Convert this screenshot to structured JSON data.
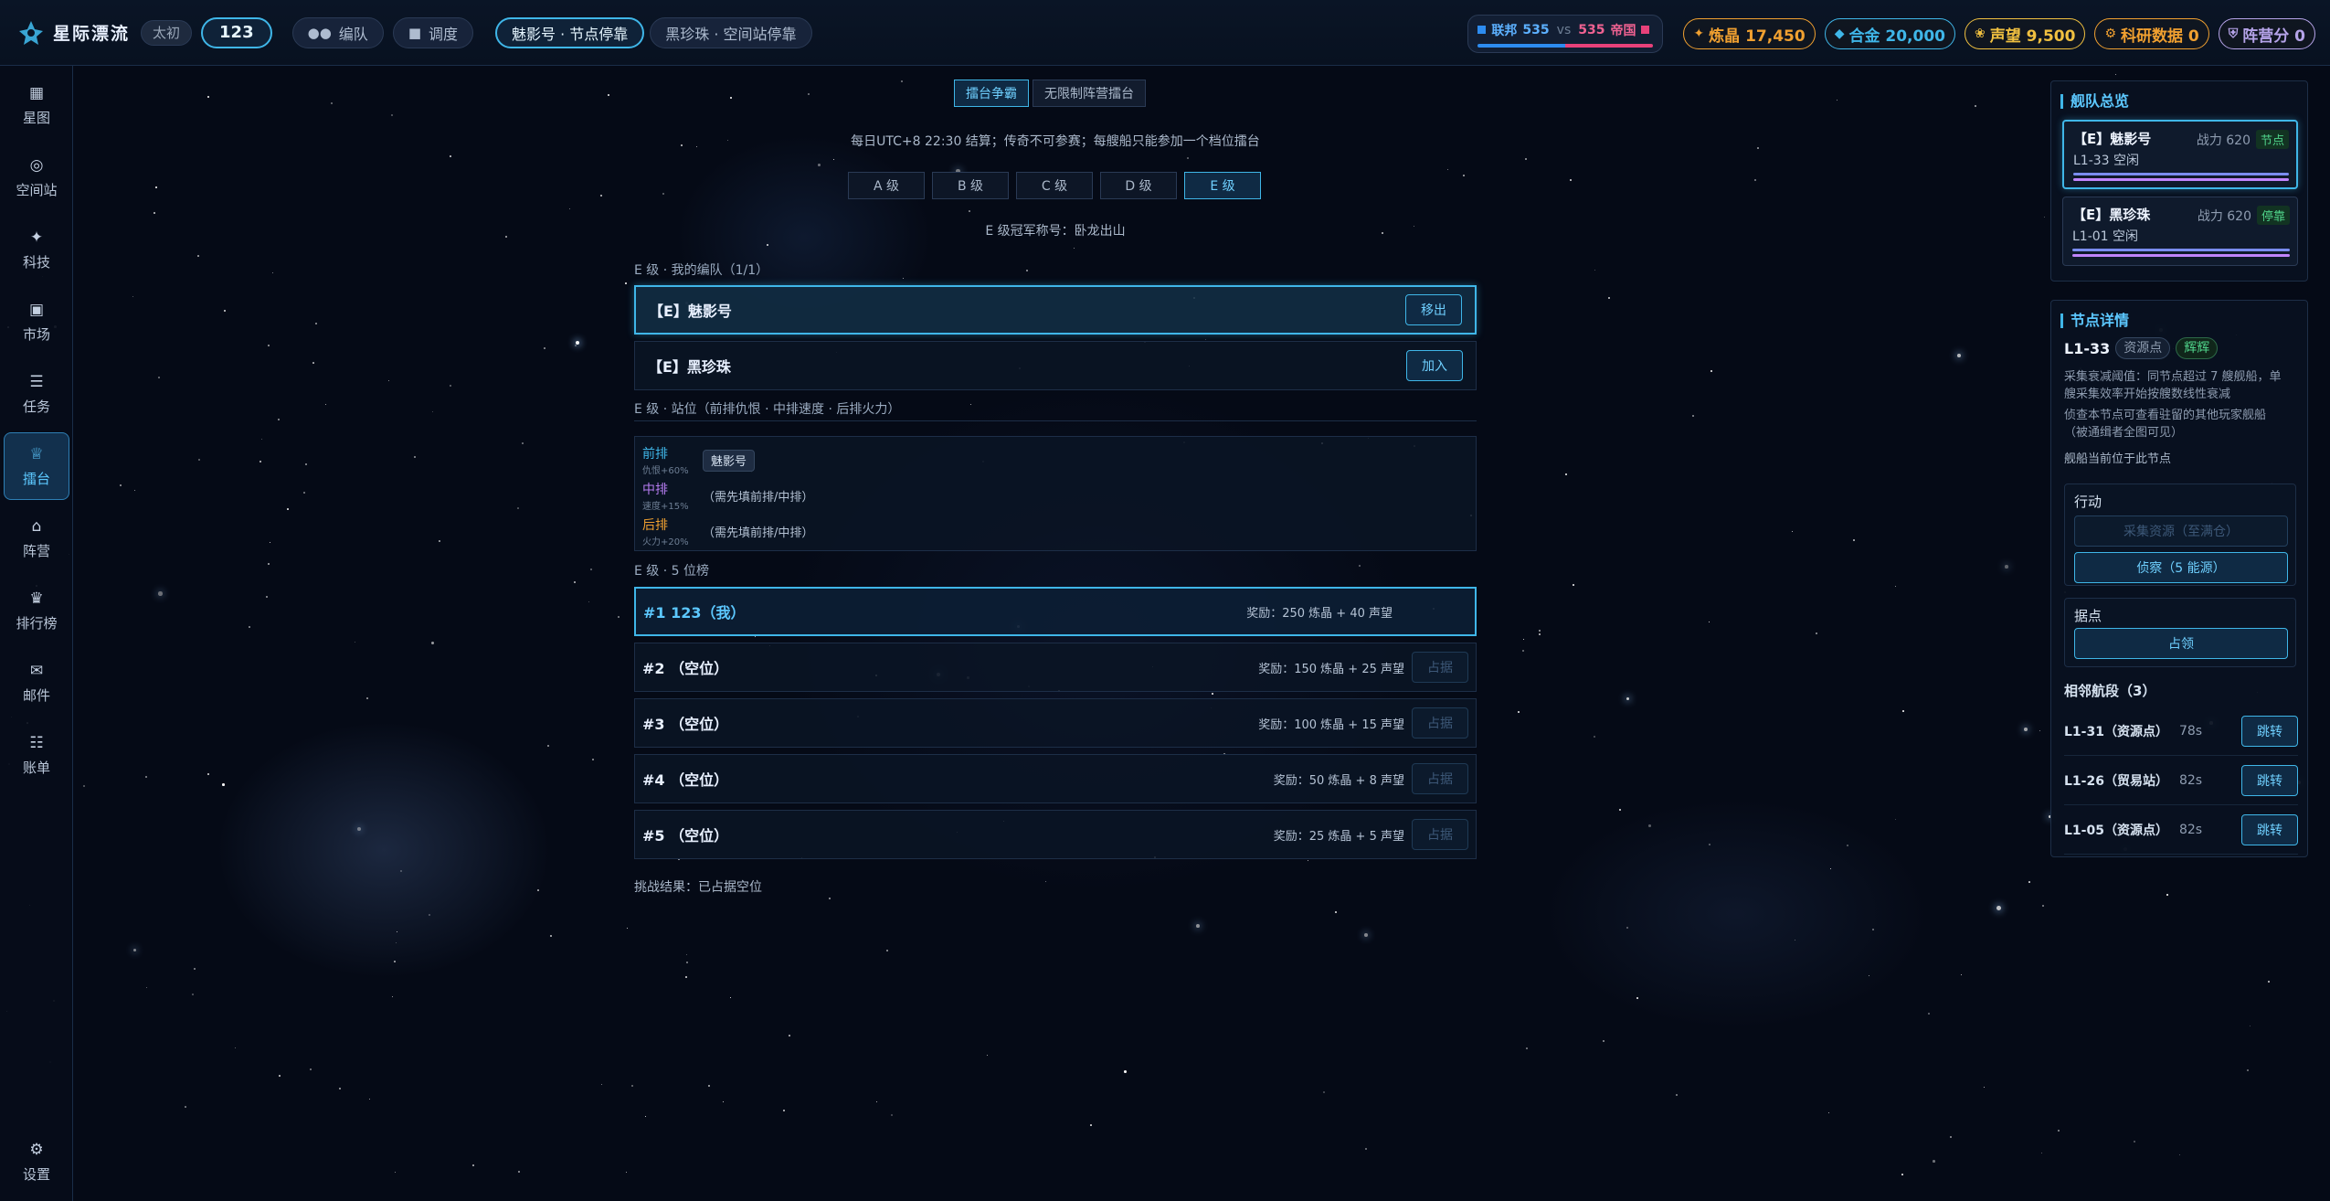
{
  "app": {
    "title": "星际漂流",
    "era_tag": "太初",
    "player_number": "123"
  },
  "topnav": [
    {
      "label": "编队",
      "icon": "users-icon"
    },
    {
      "label": "调度",
      "icon": "layers-icon"
    }
  ],
  "fleet_tabs": [
    {
      "label": "魅影号 · 节点停靠",
      "active": true
    },
    {
      "label": "黑珍珠 · 空间站停靠",
      "active": false
    }
  ],
  "faction": {
    "left_name": "联邦",
    "left_count": "535",
    "vs": "vs",
    "right_count": "535",
    "right_name": "帝国",
    "left_color": "#2d8cf0",
    "right_color": "#e8417a",
    "left_share": 0.5
  },
  "resources": [
    {
      "icon": "crystal-icon",
      "label": "炼晶 17,450",
      "color": "#f0a030"
    },
    {
      "icon": "alloy-icon",
      "label": "合金 20,000",
      "color": "#3fb6e8"
    },
    {
      "icon": "fame-icon",
      "label": "声望 9,500",
      "color": "#f0c040"
    },
    {
      "icon": "research-icon",
      "label": "科研数据 0",
      "color": "#f0a030"
    },
    {
      "icon": "shield-icon",
      "label": "阵营分 0",
      "color": "#b5a3e8"
    }
  ],
  "sidebar": [
    {
      "label": "星图",
      "icon": "map-icon",
      "active": false
    },
    {
      "label": "空间站",
      "icon": "station-icon",
      "active": false
    },
    {
      "label": "科技",
      "icon": "tech-icon",
      "active": false
    },
    {
      "label": "市场",
      "icon": "market-icon",
      "active": false
    },
    {
      "label": "任务",
      "icon": "task-icon",
      "active": false
    },
    {
      "label": "擂台",
      "icon": "trophy-icon",
      "active": true
    },
    {
      "label": "阵营",
      "icon": "camp-icon",
      "active": false
    },
    {
      "label": "排行榜",
      "icon": "crown-icon",
      "active": false
    },
    {
      "label": "邮件",
      "icon": "mail-icon",
      "active": false
    },
    {
      "label": "账单",
      "icon": "bill-icon",
      "active": false
    }
  ],
  "settings_label": "设置",
  "arena": {
    "mode_tabs": [
      {
        "label": "擂台争霸",
        "active": true
      },
      {
        "label": "无限制阵营擂台",
        "active": false
      }
    ],
    "notice": "每日UTC+8 22:30 结算；传奇不可参赛；每艘船只能参加一个档位擂台",
    "grades": [
      {
        "label": "A 级",
        "active": false
      },
      {
        "label": "B 级",
        "active": false
      },
      {
        "label": "C 级",
        "active": false
      },
      {
        "label": "D 级",
        "active": false
      },
      {
        "label": "E 级",
        "active": true
      }
    ],
    "champion": "E 级冠军称号：卧龙出山",
    "my_fleet_title": "E 级 · 我的编队（1/1）",
    "my_fleets": [
      {
        "name": "【E】魅影号",
        "action": "移出",
        "selected": true
      },
      {
        "name": "【E】黑珍珠",
        "action": "加入",
        "selected": false
      }
    ],
    "positions_title": "E 级 · 站位（前排仇恨 · 中排速度 · 后排火力）",
    "positions": [
      {
        "label": "前排",
        "bonus": "仇恨+60%",
        "color": "#3fb6e8",
        "chip": "魅影号",
        "text": ""
      },
      {
        "label": "中排",
        "bonus": "速度+15%",
        "color": "#b57cf0",
        "chip": "",
        "text": "（需先填前排/中排）"
      },
      {
        "label": "后排",
        "bonus": "火力+20%",
        "color": "#f0a030",
        "chip": "",
        "text": "（需先填前排/中排）"
      }
    ],
    "ranking_title": "E 级 · 5 位榜",
    "ranking": [
      {
        "title": "#1 123（我）",
        "reward": "奖励：250 炼晶 + 40 声望",
        "action": "",
        "mine": true
      },
      {
        "title": "#2 （空位）",
        "reward": "奖励：150 炼晶 + 25 声望",
        "action": "占据",
        "mine": false
      },
      {
        "title": "#3 （空位）",
        "reward": "奖励：100 炼晶 + 15 声望",
        "action": "占据",
        "mine": false
      },
      {
        "title": "#4 （空位）",
        "reward": "奖励：50 炼晶 + 8 声望",
        "action": "占据",
        "mine": false
      },
      {
        "title": "#5 （空位）",
        "reward": "奖励：25 炼晶 + 5 声望",
        "action": "占据",
        "mine": false
      }
    ],
    "result": "挑战结果：已占据空位"
  },
  "right_panel": {
    "overview_title": "舰队总览",
    "fleets": [
      {
        "name": "【E】魅影号",
        "power": "战力 620",
        "state": "节点",
        "location": "L1-33 空闲",
        "bar1": "#7a8cf0",
        "bar2": "#c084fc",
        "selected": true
      },
      {
        "name": "【E】黑珍珠",
        "power": "战力 620",
        "state": "停靠",
        "location": "L1-01 空闲",
        "bar1": "#7a8cf0",
        "bar2": "#c084fc",
        "selected": false
      }
    ],
    "node_title": "节点详情",
    "node_id": "L1-33",
    "node_chips": [
      {
        "label": "资源点",
        "color": "#8e9cb0"
      },
      {
        "label": "辉辉",
        "color": "#4fd38a"
      }
    ],
    "node_desc": [
      "采集衰减阈值：同节点超过 7 艘舰船，单",
      "艘采集效率开始按艘数线性衰减"
    ],
    "node_desc2": [
      "侦查本节点可查看驻留的其他玩家舰船",
      "（被通缉者全图可见）"
    ],
    "node_here": "舰船当前位于此节点",
    "action_title": "行动",
    "action_buttons": [
      {
        "label": "采集资源（至满仓）",
        "enabled": false
      },
      {
        "label": "侦察（5 能源）",
        "enabled": true
      }
    ],
    "stronghold_title": "据点",
    "stronghold_button": "占领",
    "adjacent_title": "相邻航段（3）",
    "adjacent": [
      {
        "name": "L1-31（资源点）",
        "time": "78s",
        "action": "跳转"
      },
      {
        "name": "L1-26（贸易站）",
        "time": "82s",
        "action": "跳转"
      },
      {
        "name": "L1-05（资源点）",
        "time": "82s",
        "action": "跳转"
      }
    ]
  }
}
